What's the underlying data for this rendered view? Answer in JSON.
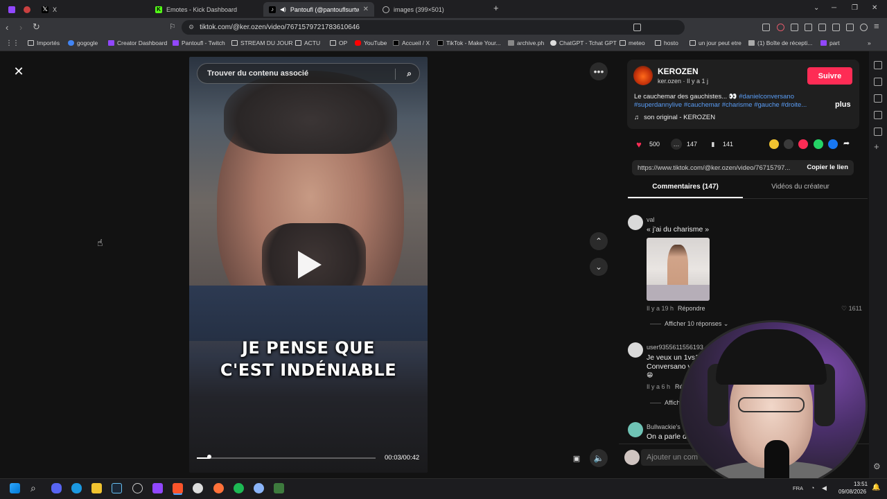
{
  "browser": {
    "tabs": [
      {
        "label": "X",
        "active": false
      },
      {
        "label": "Emotes - Kick Dashboard",
        "active": false
      },
      {
        "label": "Pantoufl (@pantouflsurtwitch",
        "active": true
      },
      {
        "label": "images (399×501)",
        "active": false
      }
    ],
    "url": "tiktok.com/@ker.ozen/video/7671579721783610646",
    "bookmarks": [
      "Importés",
      "gogogle",
      "Creator Dashboard",
      "Pantoufl - Twitch",
      "STREAM DU JOUR",
      "ACTU",
      "OP",
      "YouTube",
      "Accueil / X",
      "TikTok - Make Your...",
      "archive.ph",
      "ChatGPT - Tchat GPT",
      "meteo",
      "hosto",
      "un jour peut etre",
      "(1) Boîte de récepti...",
      "part"
    ],
    "extension_badge": "2"
  },
  "video": {
    "search_placeholder": "Trouver du contenu associé",
    "caption_line1": "JE PENSE QUE",
    "caption_line2": "C'EST INDÉNIABLE",
    "current_time": "00:03",
    "duration": "00:42",
    "time_display": "00:03/00:42",
    "progress": 0.07
  },
  "author": {
    "name": "KEROZEN",
    "handle_meta": "ker.ozen · Il y a 1 j",
    "follow_label": "Suivre",
    "description_text": "Le cauchemar des gauchistes... 👀",
    "hashtags_line1": "#danielconversano",
    "hashtags_line2": "#superdannylive #cauchemar #charisme #gauche #droite...",
    "more_label": "plus",
    "sound": "son original - KEROZEN"
  },
  "stats": {
    "likes": "500",
    "comments": "147",
    "saves": "141"
  },
  "share": {
    "link": "https://www.tiktok.com/@ker.ozen/video/76715797...",
    "copy_label": "Copier le lien"
  },
  "panel_tabs": {
    "comments": "Commentaires (147)",
    "videos": "Vidéos du créateur"
  },
  "comments": [
    {
      "user": "val",
      "text": "« j'ai du charisme »",
      "time": "Il y a 19 h",
      "reply_label": "Répondre",
      "likes": "1611",
      "show_replies": "Afficher 10 réponses"
    },
    {
      "user": "user93556115561​93",
      "text_line1": "Je veux un 1vs1",
      "text_line2": "Conversano v",
      "time": "Il y a 6 h",
      "reply_label": "Ré",
      "show_replies": "Affich"
    },
    {
      "user": "Bullwackie's",
      "text": "On a parle de"
    }
  ],
  "comment_input": {
    "placeholder": "Ajouter un com"
  },
  "system": {
    "time": "13:51",
    "date": "09/08/2026",
    "lang": "FRA"
  },
  "colors": {
    "accent": "#fe2c55",
    "hashtag": "#5a9df5",
    "page_bg": "#121212"
  }
}
